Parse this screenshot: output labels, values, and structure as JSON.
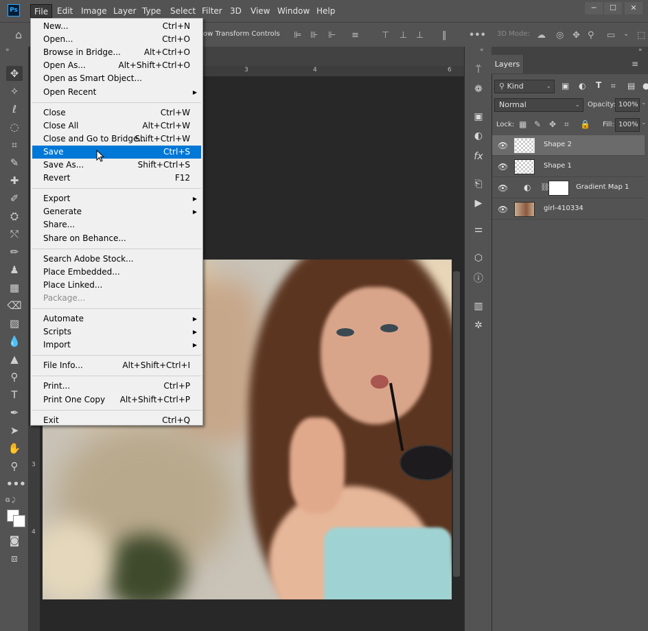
{
  "app": {
    "logo": "Ps"
  },
  "menubar": [
    "File",
    "Edit",
    "Image",
    "Layer",
    "Type",
    "Select",
    "Filter",
    "3D",
    "View",
    "Window",
    "Help"
  ],
  "window_controls": [
    "─",
    "☐",
    "✕"
  ],
  "options_bar": {
    "transform_label": "ow Transform Controls",
    "mode_label": "3D Mode:"
  },
  "rulers": {
    "top": [
      "3",
      "4",
      "6"
    ],
    "left": [
      "3",
      "4"
    ]
  },
  "file_menu": {
    "groups": [
      [
        {
          "label": "New...",
          "shortcut": "Ctrl+N"
        },
        {
          "label": "Open...",
          "shortcut": "Ctrl+O"
        },
        {
          "label": "Browse in Bridge...",
          "shortcut": "Alt+Ctrl+O"
        },
        {
          "label": "Open As...",
          "shortcut": "Alt+Shift+Ctrl+O"
        },
        {
          "label": "Open as Smart Object...",
          "shortcut": ""
        },
        {
          "label": "Open Recent",
          "shortcut": "",
          "submenu": true
        }
      ],
      [
        {
          "label": "Close",
          "shortcut": "Ctrl+W"
        },
        {
          "label": "Close All",
          "shortcut": "Alt+Ctrl+W"
        },
        {
          "label": "Close and Go to Bridge...",
          "shortcut": "Shift+Ctrl+W"
        },
        {
          "label": "Save",
          "shortcut": "Ctrl+S",
          "highlighted": true
        },
        {
          "label": "Save As...",
          "shortcut": "Shift+Ctrl+S"
        },
        {
          "label": "Revert",
          "shortcut": "F12"
        }
      ],
      [
        {
          "label": "Export",
          "shortcut": "",
          "submenu": true
        },
        {
          "label": "Generate",
          "shortcut": "",
          "submenu": true
        },
        {
          "label": "Share...",
          "shortcut": ""
        },
        {
          "label": "Share on Behance...",
          "shortcut": ""
        }
      ],
      [
        {
          "label": "Search Adobe Stock...",
          "shortcut": ""
        },
        {
          "label": "Place Embedded...",
          "shortcut": ""
        },
        {
          "label": "Place Linked...",
          "shortcut": ""
        },
        {
          "label": "Package...",
          "shortcut": "",
          "disabled": true
        }
      ],
      [
        {
          "label": "Automate",
          "shortcut": "",
          "submenu": true
        },
        {
          "label": "Scripts",
          "shortcut": "",
          "submenu": true
        },
        {
          "label": "Import",
          "shortcut": "",
          "submenu": true
        }
      ],
      [
        {
          "label": "File Info...",
          "shortcut": "Alt+Shift+Ctrl+I"
        }
      ],
      [
        {
          "label": "Print...",
          "shortcut": "Ctrl+P"
        },
        {
          "label": "Print One Copy",
          "shortcut": "Alt+Shift+Ctrl+P"
        }
      ],
      [
        {
          "label": "Exit",
          "shortcut": "Ctrl+Q"
        }
      ]
    ]
  },
  "layers_panel": {
    "tab": "Layers",
    "filter": "Kind",
    "blend_mode": "Normal",
    "opacity_label": "Opacity:",
    "opacity": "100%",
    "lock_label": "Lock:",
    "fill_label": "Fill:",
    "fill": "100%",
    "layers": [
      {
        "name": "Shape 2",
        "selected": true,
        "type": "shape"
      },
      {
        "name": "Shape 1",
        "selected": false,
        "type": "shape"
      },
      {
        "name": "Gradient Map 1",
        "selected": false,
        "type": "adjustment"
      },
      {
        "name": "girl-410334",
        "selected": false,
        "type": "photo"
      }
    ]
  },
  "colors": {
    "highlight": "#0078d7",
    "shape_blue": "#0000ff",
    "panel": "#535353"
  }
}
